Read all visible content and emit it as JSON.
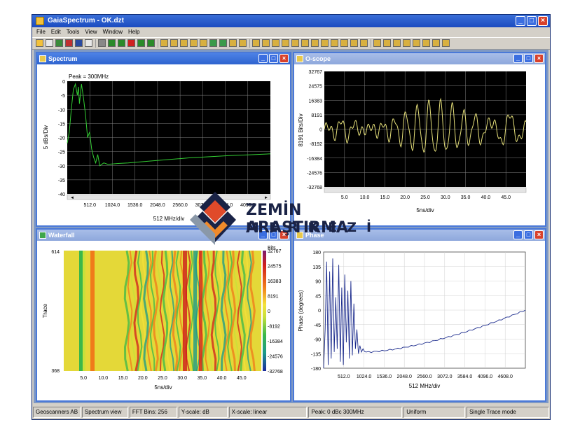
{
  "app": {
    "title": "GaiaSpectrum - OK.dzt",
    "menu": [
      "File",
      "Edit",
      "Tools",
      "View",
      "Window",
      "Help"
    ]
  },
  "spectrum": {
    "title": "Spectrum",
    "peak": "Peak = 300MHz",
    "ylabel": "5 dBs/Div",
    "xlabel": "512 MHz/div",
    "yticks": [
      "0",
      "-5",
      "-10",
      "-15",
      "-20",
      "-25",
      "-30",
      "-35",
      "-40"
    ],
    "xticks": [
      "512.0",
      "1024.0",
      "1536.0",
      "2048.0",
      "2560.0",
      "3072.0",
      "3584.0",
      "4096.0"
    ]
  },
  "oscope": {
    "title": "O-scope",
    "ylabel": "8191 Bits/Div",
    "xlabel": "5ns/div",
    "yticks": [
      "32767",
      "24575",
      "16383",
      "8191",
      "0",
      "-8192",
      "-16384",
      "-24576",
      "-32768"
    ],
    "xticks": [
      "5.0",
      "10.0",
      "15.0",
      "20.0",
      "25.0",
      "30.0",
      "35.0",
      "40.0",
      "45.0"
    ]
  },
  "waterfall": {
    "title": "Waterfall",
    "ylabel": "Trace",
    "xlabel": "5ns/div",
    "ytop": "614",
    "ybottom": "368",
    "xticks": [
      "5.0",
      "10.0",
      "15.0",
      "20.0",
      "25.0",
      "30.0",
      "35.0",
      "40.0",
      "45.0"
    ],
    "colorbar_title": "Bits",
    "colorbar_ticks": [
      "32767",
      "24575",
      "16383",
      "8191",
      "0",
      "-8192",
      "-16384",
      "-24576",
      "-32768"
    ]
  },
  "phase": {
    "title": "Phase",
    "ylabel": "Phase (degrees)",
    "xlabel": "512 MHz/div",
    "yticks": [
      "180",
      "135",
      "90",
      "45",
      "0",
      "-45",
      "-90",
      "-135",
      "-180"
    ],
    "xticks": [
      "512.0",
      "1024.0",
      "1536.0",
      "2048.0",
      "2560.0",
      "3072.0",
      "3584.0",
      "4096.0",
      "4608.0"
    ]
  },
  "status": [
    "Geoscanners AB",
    "Spectrum view",
    "FFT Bins: 256",
    "Y-scale: dB",
    "X-scale: linear",
    "Peak: 0 dBc 300MHz",
    "Uniform",
    "Single Trace mode"
  ],
  "watermark": {
    "line1": "ZEMİN ARAŞTIRMA",
    "line2": "MERKEZİ"
  },
  "colors": {
    "plot_bg": "#000000",
    "grid": "#808080",
    "spectrum_trace": "#33cc33",
    "oscope_trace": "#e6e07a",
    "phase_trace": "#1a2a8c"
  }
}
